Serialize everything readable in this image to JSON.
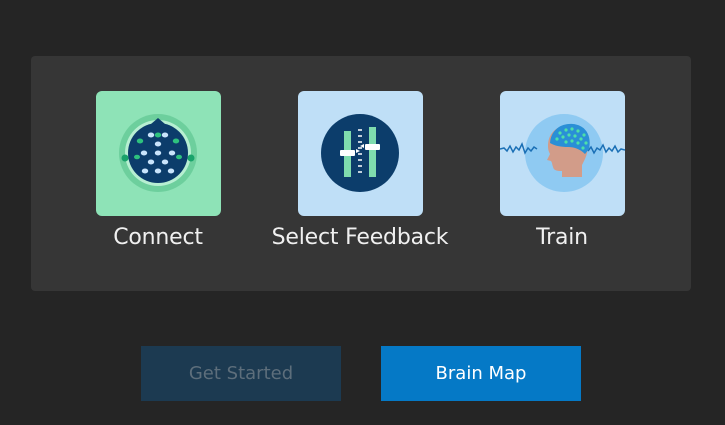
{
  "steps": [
    {
      "label": "Connect",
      "icon": "eeg-headset-icon",
      "tile_color": "#8ee3b7"
    },
    {
      "label": "Select Feedback",
      "icon": "sliders-icon",
      "tile_color": "#bfdff7"
    },
    {
      "label": "Train",
      "icon": "head-eeg-cap-icon",
      "tile_color": "#bfdff7"
    }
  ],
  "buttons": {
    "get_started": {
      "label": "Get Started",
      "enabled": false
    },
    "brain_map": {
      "label": "Brain Map",
      "enabled": true
    }
  },
  "colors": {
    "background": "#252525",
    "panel": "#363636",
    "accent": "#0579c6",
    "disabled_button": "#1c3a51",
    "icon_navy": "#0c3d6b",
    "icon_green": "#19a36b"
  }
}
